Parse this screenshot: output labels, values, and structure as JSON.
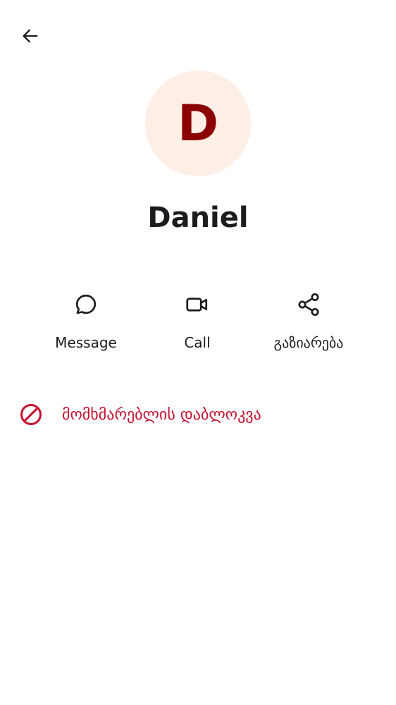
{
  "colors": {
    "avatar_bg": "#fdeee6",
    "avatar_letter": "#8b0000",
    "text_primary": "#1c1b1f",
    "danger": "#c8102e"
  },
  "header": {
    "back_icon": "arrow-left-icon"
  },
  "contact": {
    "initial": "D",
    "name": "Daniel"
  },
  "actions": [
    {
      "icon": "chat-bubble-icon",
      "label": "Message"
    },
    {
      "icon": "video-camera-icon",
      "label": "Call"
    },
    {
      "icon": "share-icon",
      "label": "გაზიარება"
    }
  ],
  "block": {
    "icon": "block-icon",
    "label": "მომხმარებლის დაბლოკვა"
  }
}
